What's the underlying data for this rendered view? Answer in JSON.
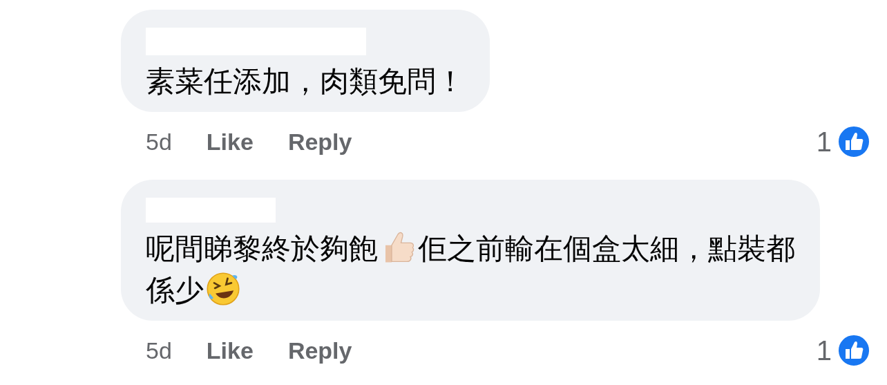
{
  "comments": [
    {
      "lines": [
        [
          {
            "kind": "text",
            "text": "素菜任添加，肉類免問！"
          }
        ]
      ],
      "time": "5d",
      "like": "Like",
      "reply": "Reply",
      "reaction_count": "1"
    },
    {
      "lines": [
        [
          {
            "kind": "text",
            "text": "呢間睇黎終於夠飽"
          },
          {
            "kind": "thumbs_up"
          },
          {
            "kind": "text",
            "text": "佢之前輸在個盒太細，點裝都"
          }
        ],
        [
          {
            "kind": "text",
            "text": "係少"
          },
          {
            "kind": "laughing"
          }
        ]
      ],
      "time": "5d",
      "like": "Like",
      "reply": "Reply",
      "reaction_count": "1"
    }
  ]
}
